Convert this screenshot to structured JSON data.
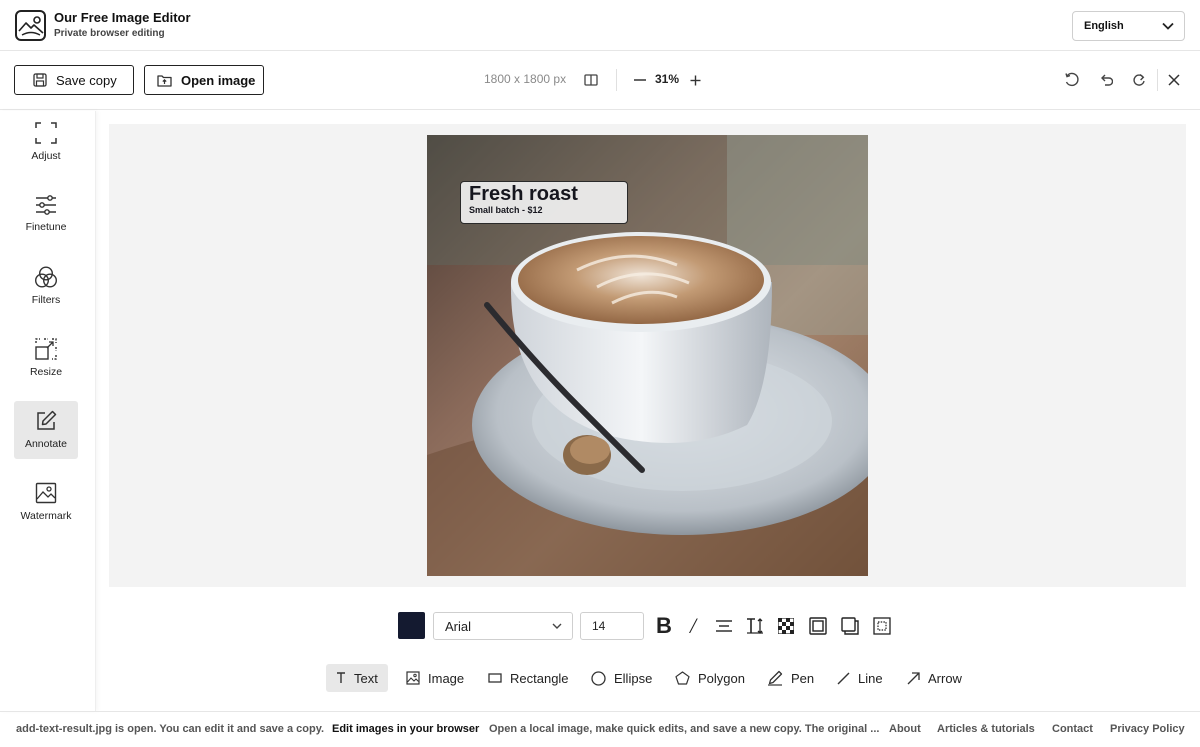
{
  "header": {
    "title": "Our Free Image Editor",
    "subtitle": "Private browser editing",
    "language": "English"
  },
  "toolbar": {
    "save_label": "Save copy",
    "open_label": "Open image",
    "dimensions": "1800 x 1800 px",
    "zoom": "31%"
  },
  "sidebar": {
    "items": [
      {
        "label": "Adjust",
        "icon": "crop-frame-icon"
      },
      {
        "label": "Finetune",
        "icon": "sliders-icon"
      },
      {
        "label": "Filters",
        "icon": "filter-circles-icon"
      },
      {
        "label": "Resize",
        "icon": "resize-icon"
      },
      {
        "label": "Annotate",
        "icon": "pencil-icon"
      },
      {
        "label": "Watermark",
        "icon": "image-icon"
      }
    ],
    "active": "Annotate"
  },
  "annotation": {
    "title": "Fresh roast",
    "subtitle": "Small batch - $12"
  },
  "text_options": {
    "color": "#141a30",
    "font": "Arial",
    "size": "14"
  },
  "tools": [
    {
      "label": "Text",
      "icon": "text-icon"
    },
    {
      "label": "Image",
      "icon": "image-icon"
    },
    {
      "label": "Rectangle",
      "icon": "rectangle-icon"
    },
    {
      "label": "Ellipse",
      "icon": "ellipse-icon"
    },
    {
      "label": "Polygon",
      "icon": "polygon-icon"
    },
    {
      "label": "Pen",
      "icon": "pen-icon"
    },
    {
      "label": "Line",
      "icon": "line-icon"
    },
    {
      "label": "Arrow",
      "icon": "arrow-icon"
    }
  ],
  "active_tool": "Text",
  "footer": {
    "status": "add-text-result.jpg is open. You can edit it and save a copy.",
    "headline": "Edit images in your browser",
    "description": "Open a local image, make quick edits, and save a new copy. The original ...",
    "links": [
      "About",
      "Articles & tutorials",
      "Contact",
      "Privacy Policy"
    ]
  }
}
